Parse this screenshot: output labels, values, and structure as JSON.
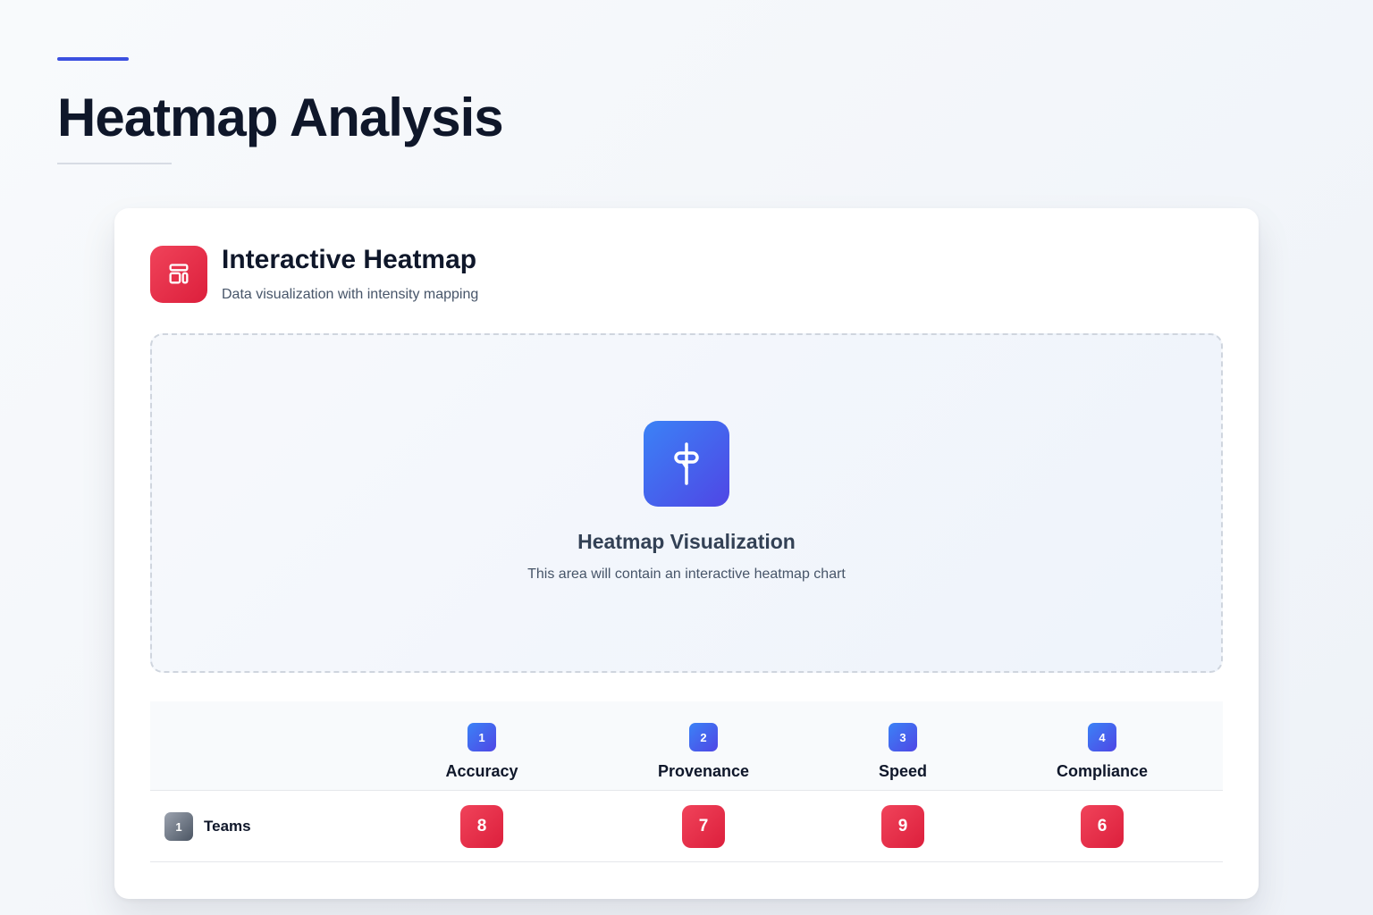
{
  "header": {
    "title": "Heatmap Analysis"
  },
  "card": {
    "title": "Interactive Heatmap",
    "subtitle": "Data visualization with intensity mapping",
    "icon": "layout-icon",
    "accent_color": "#e11d48"
  },
  "placeholder": {
    "icon": "pin-icon",
    "title": "Heatmap Visualization",
    "text": "This area will contain an interactive heatmap chart"
  },
  "table": {
    "columns": [
      {
        "index": "1",
        "label": "Accuracy"
      },
      {
        "index": "2",
        "label": "Provenance"
      },
      {
        "index": "3",
        "label": "Speed"
      },
      {
        "index": "4",
        "label": "Compliance"
      }
    ],
    "rows": [
      {
        "index": "1",
        "label": "Teams",
        "values": [
          "8",
          "7",
          "9",
          "6"
        ]
      }
    ]
  }
}
